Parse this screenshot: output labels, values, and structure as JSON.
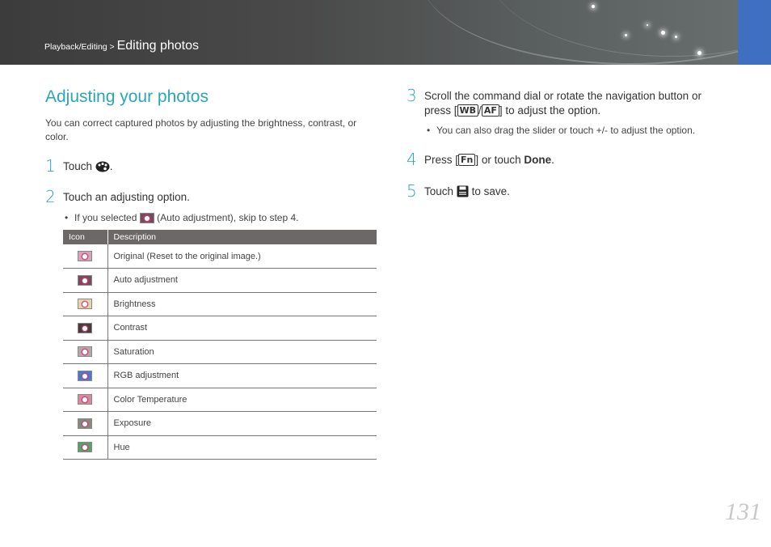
{
  "header": {
    "breadcrumb_parent": "Playback/Editing >",
    "breadcrumb_current": "Editing photos",
    "accent_color": "#3f6fc0"
  },
  "main": {
    "title": "Adjusting your photos",
    "intro": "You can correct captured photos by adjusting the brightness, contrast, or color.",
    "step1": {
      "num": "1",
      "text_before": "Touch",
      "icon": "palette-icon",
      "text_after": "."
    },
    "step2": {
      "num": "2",
      "text": "Touch an adjusting option."
    },
    "step2_bullet": {
      "before": "If you selected",
      "icon": "auto-adjust-icon",
      "after": "(Auto adjustment), skip to step 4."
    },
    "table": {
      "headers": [
        "Icon",
        "Description"
      ],
      "rows": [
        {
          "icon": "original-icon",
          "description": "Original (Reset to the original image.)",
          "color": "#d9a3b5"
        },
        {
          "icon": "auto-adjustment-icon",
          "description": "Auto adjustment",
          "color": "#7a4a5a"
        },
        {
          "icon": "brightness-icon",
          "description": "Brightness",
          "color": "#e6d6a8"
        },
        {
          "icon": "contrast-icon",
          "description": "Contrast",
          "color": "#4a3a3a"
        },
        {
          "icon": "saturation-icon",
          "description": "Saturation",
          "color": "#b9a6a6"
        },
        {
          "icon": "rgb-adjustment-icon",
          "description": "RGB adjustment",
          "color": "#4a7ad0"
        },
        {
          "icon": "color-temperature-icon",
          "description": "Color Temperature",
          "color": "#d98a9a"
        },
        {
          "icon": "exposure-icon",
          "description": "Exposure",
          "color": "#8a8a7a"
        },
        {
          "icon": "hue-icon",
          "description": "Hue",
          "color": "#5aa06a"
        }
      ]
    },
    "step3": {
      "num": "3",
      "text_line1": "Scroll the command dial or rotate the navigation button or",
      "text_line2_before": "press [",
      "key1": "WB",
      "slash": "/",
      "key2": "AF",
      "text_line2_after": "] to adjust the option."
    },
    "step3_bullet": "You can also drag the slider or touch +/- to adjust the option.",
    "step4": {
      "num": "4",
      "before": "Press [",
      "key": "Fn",
      "middle": "] or touch ",
      "bold": "Done",
      "after": "."
    },
    "step5": {
      "num": "5",
      "before": "Touch",
      "icon": "save-icon",
      "after": "to save."
    },
    "accent_color": "#2aa6b9"
  },
  "page_number": "131"
}
